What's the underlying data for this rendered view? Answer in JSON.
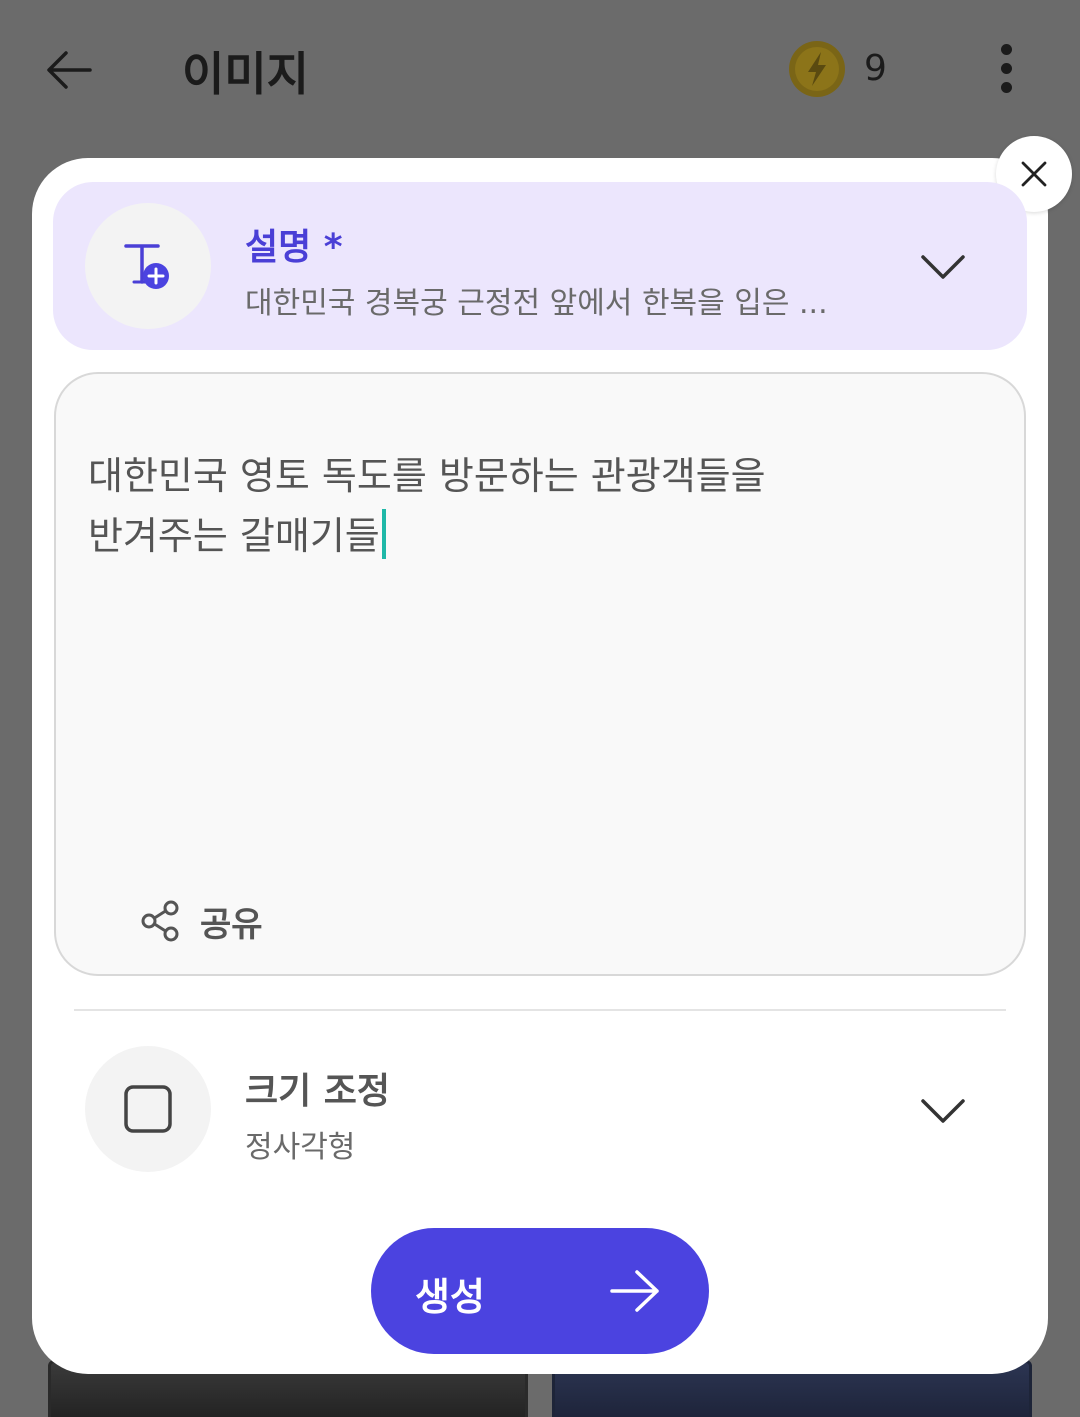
{
  "appbar": {
    "title": "이미지",
    "coin_count": "9",
    "icons": {
      "back": "arrow-left-icon",
      "coin": "lightning-coin-icon",
      "more": "more-vertical-icon"
    }
  },
  "modal": {
    "close_icon": "close-icon",
    "description": {
      "title": "설명 *",
      "summary": "대한민국 경복궁 근정전 앞에서 한복을 입은 ...",
      "icon": "text-add-icon",
      "chevron": "chevron-down-icon"
    },
    "prompt": {
      "line1": "대한민국 영토 독도를 방문하는 관광객들을",
      "line2": "반겨주는 갈매기들",
      "share_label": "공유",
      "share_icon": "share-icon"
    },
    "resize": {
      "title": "크기 조정",
      "value": "정사각형",
      "icon": "square-icon",
      "chevron": "chevron-down-icon"
    },
    "generate": {
      "label": "생성",
      "icon": "arrow-right-icon"
    }
  },
  "colors": {
    "accent": "#4b43e0",
    "accent_text": "#4a3fd6",
    "section_bg": "#ece6fd",
    "cursor": "#1fb8a8",
    "overlay": "#6b6b6b"
  }
}
